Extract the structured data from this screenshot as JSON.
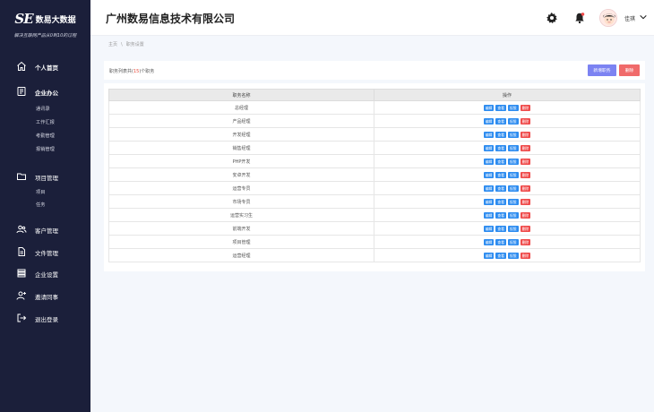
{
  "brand": {
    "mark": "SE",
    "name": "数易大数据",
    "slogan": "解决互联网产品从0到10的过程"
  },
  "sidebar": {
    "items": [
      {
        "label": "个人首页",
        "icon": "home-icon"
      },
      {
        "label": "企业办公",
        "icon": "clipboard-icon",
        "subs": [
          "通讯录",
          "工作汇报",
          "考勤管理",
          "报销管理"
        ]
      },
      {
        "label": "项目管理",
        "icon": "folder-icon",
        "subs": [
          "项目",
          "任务"
        ]
      },
      {
        "label": "客户管理",
        "icon": "users-icon"
      },
      {
        "label": "文件管理",
        "icon": "document-icon"
      },
      {
        "label": "企业设置",
        "icon": "layers-icon"
      },
      {
        "label": "邀请同事",
        "icon": "user-add-icon"
      },
      {
        "label": "退出登录",
        "icon": "logout-icon"
      }
    ]
  },
  "header": {
    "company": "广州数易信息技术有限公司",
    "username": "佳琪"
  },
  "breadcrumb": [
    "主页",
    "职务设置"
  ],
  "toolbar": {
    "count_prefix": "职务列表共(",
    "count_num": "15",
    "count_suffix": ")个职务",
    "add_label": "新增职务",
    "delete_label": "删除"
  },
  "table": {
    "headers": [
      "职务名称",
      "操作"
    ],
    "ops": [
      "编辑",
      "查看",
      "权限",
      "删除"
    ],
    "rows": [
      "总经理",
      "产品经理",
      "开发经理",
      "销售经理",
      "PHP开发",
      "安卓开发",
      "运营专员",
      "市场专员",
      "运营实习生",
      "前端开发",
      "项目管理",
      "运营经理"
    ]
  },
  "colors": {
    "sidebar_bg": "#1b1f3a",
    "primary_blue": "#2d8cf0",
    "danger_red": "#ef4b4b",
    "add_purple": "#7c83f2"
  }
}
